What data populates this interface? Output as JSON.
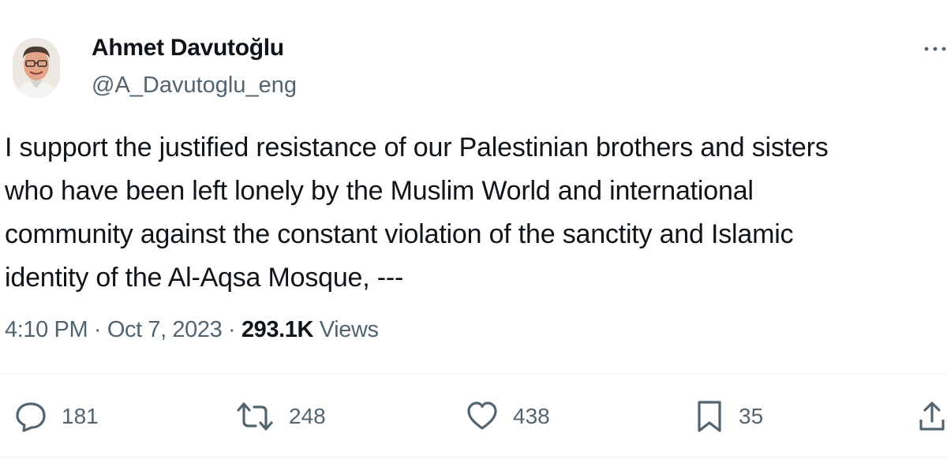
{
  "author": {
    "name": "Ahmet Davutoğlu",
    "handle": "@A_Davutoglu_eng"
  },
  "tweet": {
    "text": "I support the justified resistance of our Palestinian brothers and sisters\nwho have been left lonely  by the Muslim World and international\ncommunity against the constant violation of the sanctity and Islamic\nidentity of the Al-Aqsa Mosque, ---"
  },
  "meta": {
    "time": "4:10 PM",
    "separator": "·",
    "date": "Oct 7, 2023",
    "views_count": "293.1K",
    "views_label": "Views"
  },
  "actions": {
    "replies": "181",
    "retweets": "248",
    "likes": "438",
    "bookmarks": "35"
  },
  "icons": {
    "more": "more-horizontal-icon",
    "reply": "speech-bubble-icon",
    "retweet": "retweet-arrows-icon",
    "like": "heart-icon",
    "bookmark": "bookmark-icon",
    "share": "share-upload-icon"
  },
  "colors": {
    "text_primary": "#0f1419",
    "text_secondary": "#536471",
    "divider": "#eff3f4"
  }
}
